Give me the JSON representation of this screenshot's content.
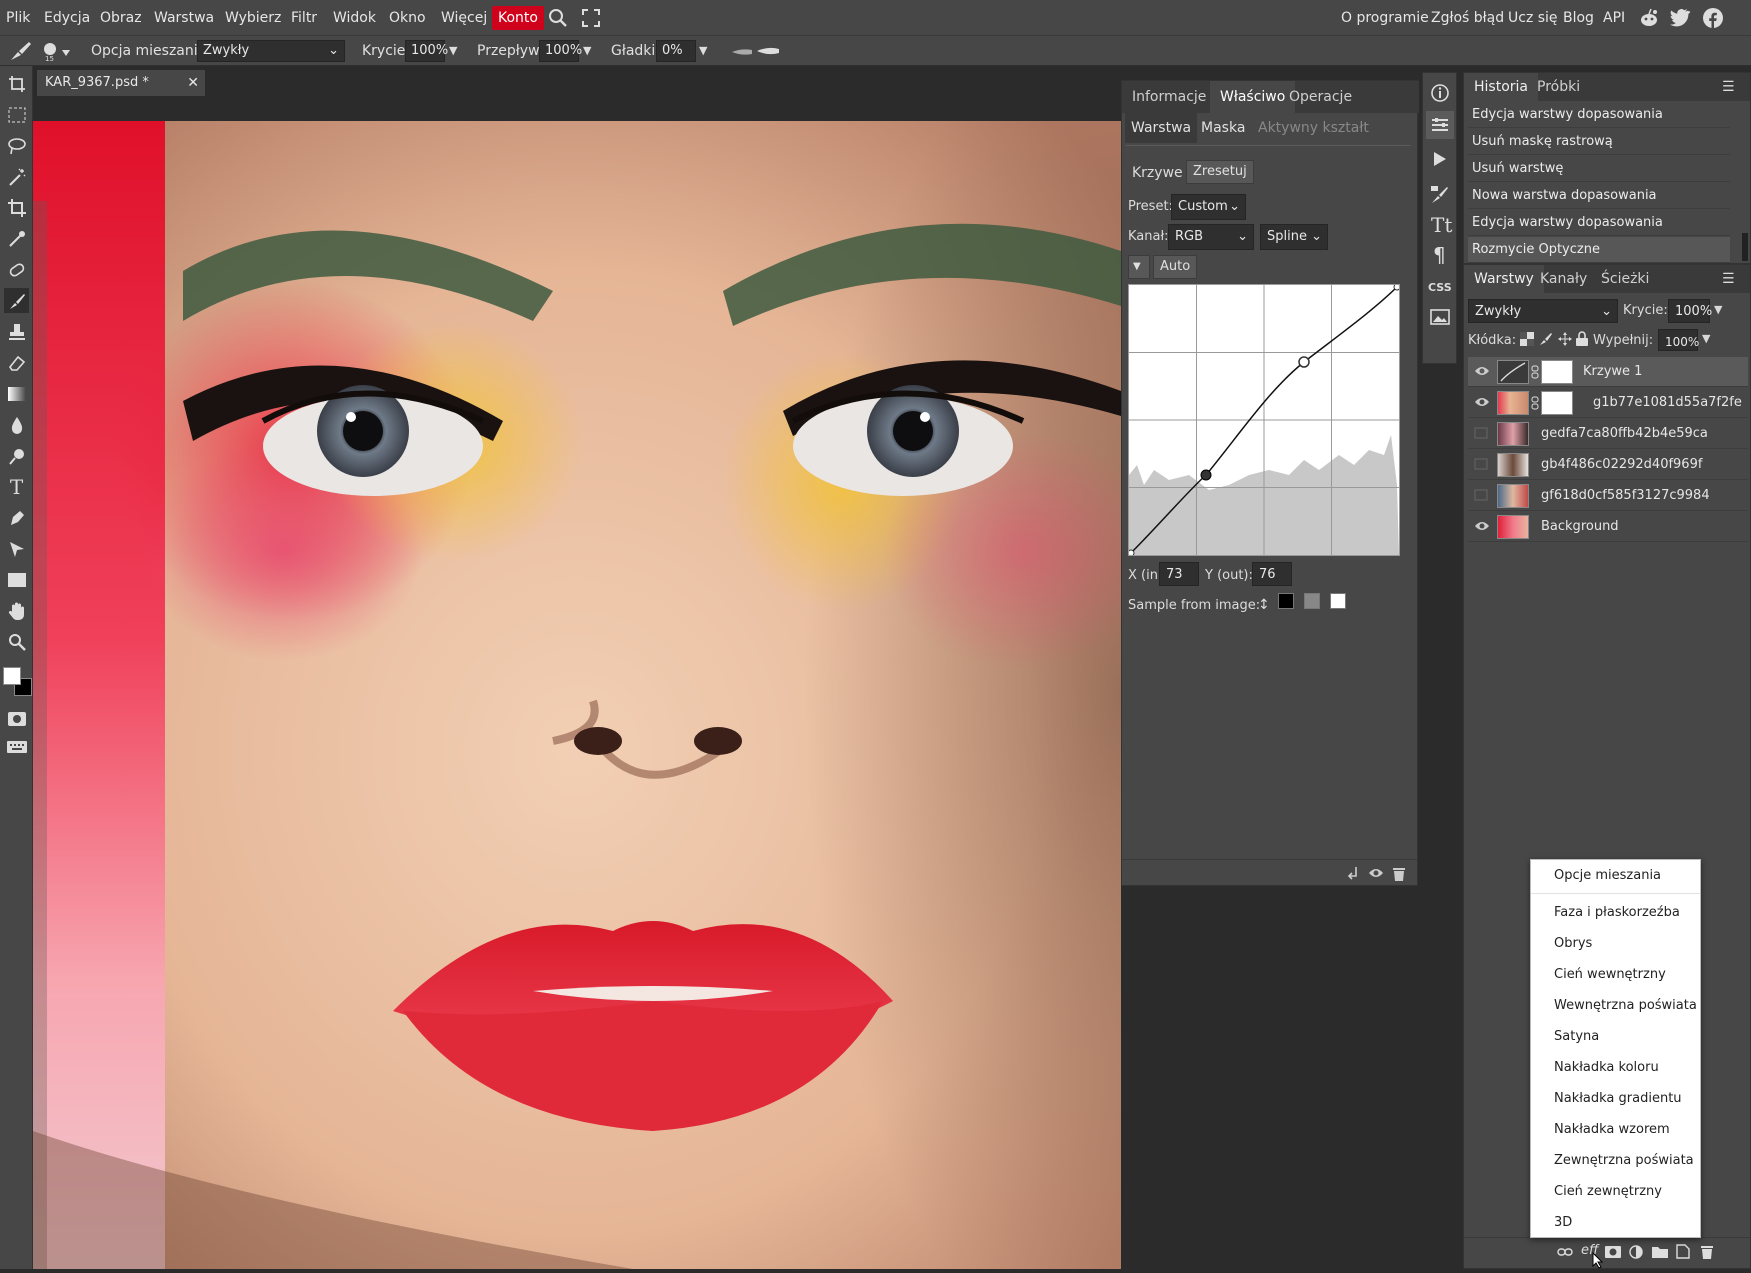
{
  "menu": {
    "items": [
      "Plik",
      "Edycja",
      "Obraz",
      "Warstwa",
      "Wybierz",
      "Filtr",
      "Widok",
      "Okno",
      "Więcej"
    ],
    "account": "Konto",
    "right": [
      "O programie",
      "Zgłoś błąd",
      "Ucz się",
      "Blog",
      "API"
    ]
  },
  "options": {
    "blend_label": "Opcja mieszania:",
    "blend_value": "Zwykły",
    "opacity_label": "Krycie:",
    "opacity_value": "100%",
    "flow_label": "Przepływ:",
    "flow_value": "100%",
    "smooth_label": "Gładki:",
    "smooth_value": "0%",
    "brush_size": "15"
  },
  "document": {
    "tab": "KAR_9367.psd *"
  },
  "properties": {
    "tabs": [
      "Informacje",
      "Właściwo",
      "Operacje"
    ],
    "subtabs": [
      "Warstwa",
      "Maska",
      "Aktywny kształt"
    ],
    "curves_label": "Krzywe",
    "reset_label": "Zresetuj",
    "preset_label": "Preset:",
    "preset_value": "Custom",
    "channel_label": "Kanał:",
    "channel_value": "RGB",
    "interp_value": "Spline",
    "auto_label": "Auto",
    "x_label": "X (in):",
    "x_value": "73",
    "y_label": "Y (out):",
    "y_value": "76",
    "sample_label": "Sample from image:",
    "sample_icon": "↕"
  },
  "history": {
    "tabs": [
      "Historia",
      "Próbki"
    ],
    "items": [
      "Edycja warstwy dopasowania",
      "Usuń maskę rastrową",
      "Usuń warstwę",
      "Nowa warstwa dopasowania",
      "Edycja warstwy dopasowania",
      "Rozmycie Optyczne"
    ]
  },
  "layers_panel": {
    "tabs": [
      "Warstwy",
      "Kanały",
      "Ścieżki"
    ],
    "blend_value": "Zwykły",
    "opacity_label": "Krycie:",
    "opacity_value": "100%",
    "lock_label": "Kłódka:",
    "fill_label": "Wypełnij:",
    "fill_value": "100%",
    "layers": [
      {
        "name": "Krzywe 1",
        "visible": true
      },
      {
        "name": "g1b77e1081d55a7f2fe",
        "visible": true
      },
      {
        "name": "gedfa7ca80ffb42b4e59ca",
        "visible": false
      },
      {
        "name": "gb4f486c02292d40f969f",
        "visible": false
      },
      {
        "name": "gf618d0cf585f3127c9984",
        "visible": false
      },
      {
        "name": "Background",
        "visible": true
      }
    ],
    "footer_fx": "eff"
  },
  "context_menu": {
    "items": [
      "Opcje mieszania",
      "Faza i płaskorzeźba",
      "Obrys",
      "Cień wewnętrzny",
      "Wewnętrzna poświata",
      "Satyna",
      "Nakładka koloru",
      "Nakładka gradientu",
      "Nakładka wzorem",
      "Zewnętrzna poświata",
      "Cień zewnętrzny",
      "3D"
    ]
  },
  "colors": {
    "accent": "#d0021b",
    "panel": "#474747",
    "bg": "#2b2b2b"
  }
}
